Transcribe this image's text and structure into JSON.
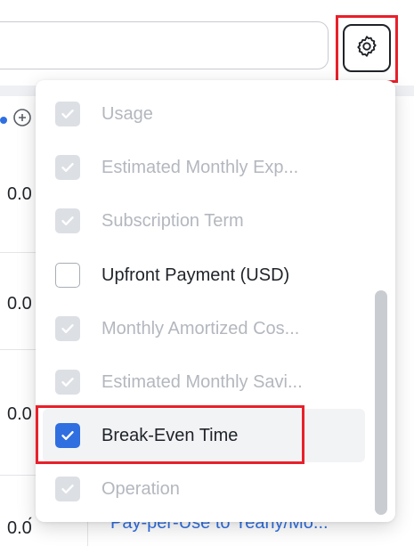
{
  "search": {
    "value": "",
    "placeholder": ""
  },
  "settings_button": {
    "icon": "gear-icon",
    "highlight_color": "#e8202a"
  },
  "table": {
    "cells": [
      "0.0",
      "0.0",
      "0.0",
      "0.0́"
    ],
    "header_icons": [
      "blue-indicator",
      "sort-icon"
    ]
  },
  "columns_menu": {
    "options": [
      {
        "label": "Usage",
        "state": "checked",
        "disabled": true
      },
      {
        "label": "Estimated Monthly Exp...",
        "state": "checked",
        "disabled": true
      },
      {
        "label": "Subscription Term",
        "state": "checked",
        "disabled": true
      },
      {
        "label": "Upfront Payment (USD)",
        "state": "unchecked",
        "disabled": false
      },
      {
        "label": "Monthly Amortized Cos...",
        "state": "checked",
        "disabled": true
      },
      {
        "label": "Estimated Monthly Savi...",
        "state": "checked",
        "disabled": true
      },
      {
        "label": "Break-Even Time",
        "state": "checked",
        "disabled": false
      },
      {
        "label": "Operation",
        "state": "checked",
        "disabled": true
      }
    ],
    "highlighted_option": "Break-Even Time"
  },
  "bottom_link": {
    "text": "Pay-per-Use to Yearly/Mo..."
  },
  "colors": {
    "accent": "#2f6fe0",
    "highlight": "#e8202a",
    "disabled_text": "#b3b7be",
    "disabled_checkbox": "#dcdfe4"
  }
}
